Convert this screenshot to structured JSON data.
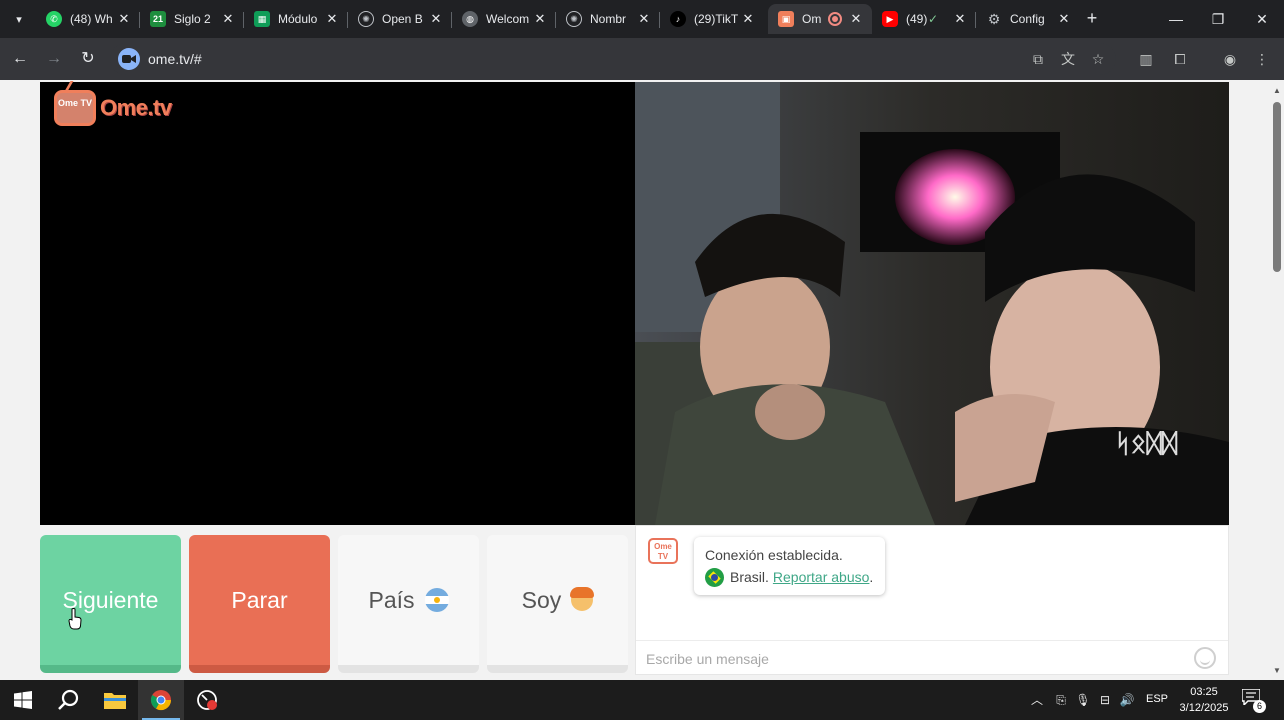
{
  "browser": {
    "tabs": [
      {
        "title": "(48) Wh",
        "favicon": "whatsapp-icon",
        "color": "#25d366",
        "active": false
      },
      {
        "title": "Siglo 2",
        "favicon": "siglo21-icon",
        "color": "#1e8e3e",
        "active": false
      },
      {
        "title": "Módulo",
        "favicon": "calendar-icon",
        "color": "#0f9d58",
        "active": false
      },
      {
        "title": "Open B",
        "favicon": "openai-icon",
        "color": "#9aa0a6",
        "active": false
      },
      {
        "title": "Welcom",
        "favicon": "globe-icon",
        "color": "#9aa0a6",
        "active": false
      },
      {
        "title": "Nombr",
        "favicon": "openai-icon",
        "color": "#9aa0a6",
        "active": false
      },
      {
        "title": "(29)TikT",
        "favicon": "tiktok-icon",
        "color": "#000000",
        "active": false
      },
      {
        "title": "Om",
        "favicon": "ometv-icon",
        "color": "#f07f5b",
        "active": true
      },
      {
        "title": "(49)",
        "favicon": "youtube-icon",
        "color": "#ff0000",
        "active": false
      },
      {
        "title": "Config",
        "favicon": "gear-icon",
        "color": "#9aa0a6",
        "active": false
      }
    ],
    "url": "ome.tv/#"
  },
  "page": {
    "logo_text": "Ome.tv",
    "logo_small": "Ome TV",
    "buttons": {
      "next": "Siguiente",
      "stop": "Parar",
      "country": "País",
      "gender": "Soy"
    },
    "chat": {
      "status": "Conexión establecida.",
      "country": "Brasil.",
      "report": "Reportar abuso",
      "report_suffix": ".",
      "placeholder": "Escribe un mensaje"
    }
  },
  "taskbar": {
    "language": "ESP",
    "time": "03:25",
    "date": "3/12/2025",
    "notifications": "6"
  },
  "colors": {
    "next": "#6dd3a2",
    "stop": "#e96f55",
    "brand": "#f07f5b",
    "link": "#3fa787"
  }
}
